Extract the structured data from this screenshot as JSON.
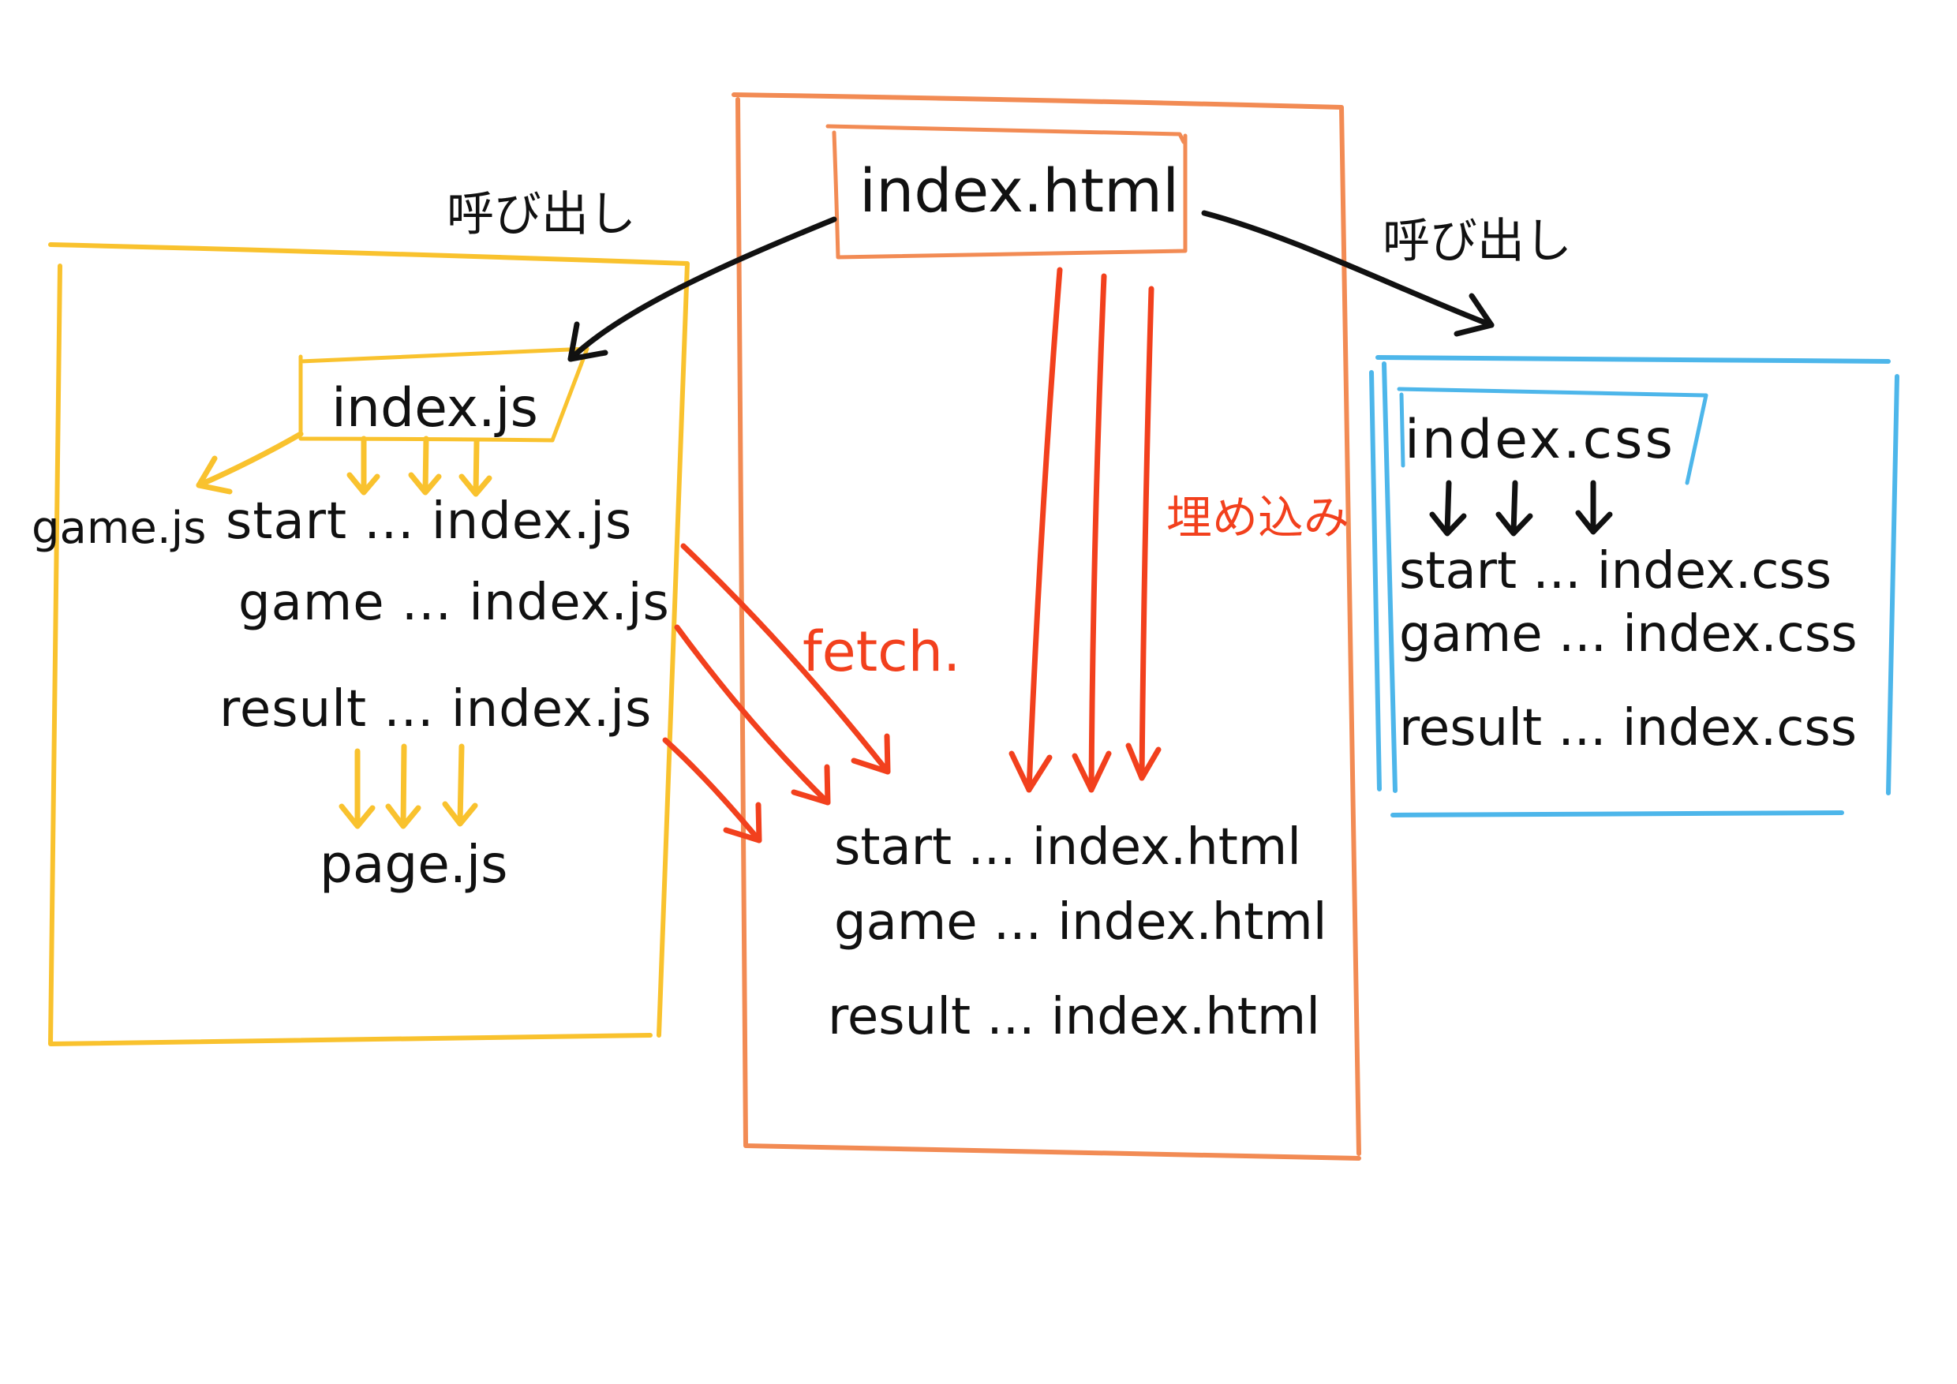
{
  "left_panel": {
    "call_label": "呼び出し",
    "entry_file": "index.js",
    "side_file": "game.js",
    "pages": [
      "start ... index.js",
      "game ... index.js",
      "result ... index.js"
    ],
    "shared_file": "page.js"
  },
  "center_panel": {
    "entry_file": "index.html",
    "embed_label": "埋め込み",
    "fetch_label": "fetch.",
    "pages": [
      "start ... index.html",
      "game ... index.html",
      "result ... index.html"
    ]
  },
  "right_panel": {
    "call_label": "呼び出し",
    "entry_file": "index.css",
    "pages": [
      "start ... index.css",
      "game ... index.css",
      "result ... index.css"
    ]
  },
  "colors": {
    "left_group": "#F9C22E",
    "center_group": "#F28B54",
    "right_group": "#4DB6EA",
    "red_arrows": "#F2401D",
    "ink": "#111111"
  }
}
